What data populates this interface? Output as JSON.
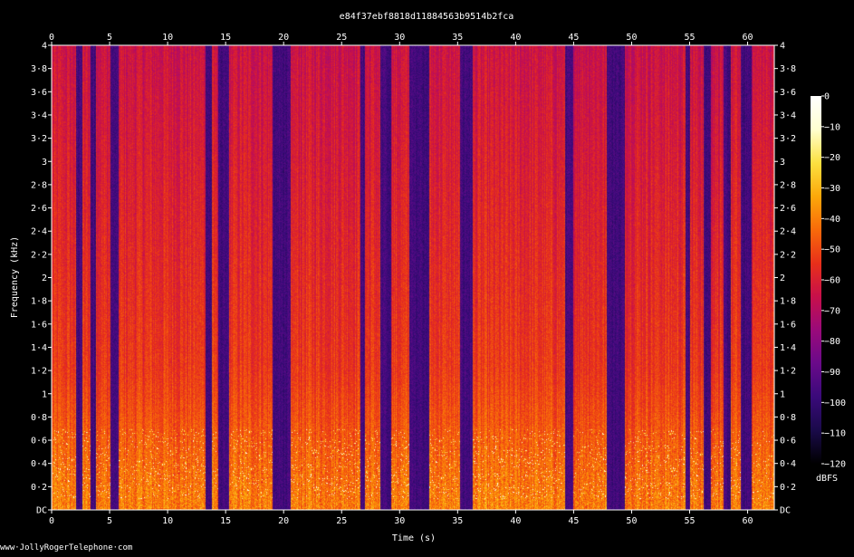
{
  "chart_data": {
    "type": "heatmap",
    "title": "e84f37ebf8818d11884563b9514b2fca",
    "xlabel": "Time (s)",
    "ylabel": "Frequency (kHz)",
    "xlim": [
      0,
      62.3
    ],
    "ylim": [
      0,
      4
    ],
    "x_ticks": [
      0,
      5,
      10,
      15,
      20,
      25,
      30,
      35,
      40,
      45,
      50,
      55,
      60
    ],
    "x_tick_labels": [
      "0",
      "5",
      "10",
      "15",
      "20",
      "25",
      "30",
      "35",
      "40",
      "45",
      "50",
      "55",
      "60"
    ],
    "y_ticks": [
      0,
      0.2,
      0.4,
      0.6,
      0.8,
      1,
      1.2,
      1.4,
      1.6,
      1.8,
      2,
      2.2,
      2.4,
      2.6,
      2.8,
      3,
      3.2,
      3.4,
      3.6,
      3.8,
      4
    ],
    "y_tick_labels": [
      "DC",
      "0·2",
      "0·4",
      "0·6",
      "0·8",
      "1",
      "1·2",
      "1·4",
      "1·6",
      "1·8",
      "2",
      "2·2",
      "2·4",
      "2·6",
      "2·8",
      "3",
      "3·2",
      "3·4",
      "3·6",
      "3·8",
      "4"
    ],
    "colorbar": {
      "label": "dBFS",
      "range": [
        -120,
        0
      ],
      "ticks": [
        0,
        -10,
        -20,
        -30,
        -40,
        -50,
        -60,
        -70,
        -80,
        -90,
        -100,
        -110,
        -120
      ],
      "tick_labels": [
        "0",
        "−10",
        "−20",
        "−30",
        "−40",
        "−50",
        "−60",
        "−70",
        "−80",
        "−90",
        "−100",
        "−110",
        "−120"
      ],
      "colormap": [
        "#000000",
        "#1a0a4a",
        "#3a0a7a",
        "#6a0a8a",
        "#9a0a7a",
        "#c8104a",
        "#e8301a",
        "#f86a0a",
        "#fca80a",
        "#fce040",
        "#ffffd0",
        "#ffffff"
      ]
    },
    "silent_intervals_s": [
      [
        2.1,
        2.6
      ],
      [
        3.3,
        3.8
      ],
      [
        5.0,
        5.7
      ],
      [
        13.2,
        13.8
      ],
      [
        14.3,
        15.3
      ],
      [
        19.0,
        20.6
      ],
      [
        26.6,
        27.0
      ],
      [
        28.3,
        29.2
      ],
      [
        30.8,
        32.5
      ],
      [
        35.2,
        36.3
      ],
      [
        44.2,
        44.9
      ],
      [
        47.8,
        49.4
      ],
      [
        54.6,
        55.0
      ],
      [
        56.2,
        56.8
      ],
      [
        57.9,
        58.5
      ],
      [
        59.4,
        60.3
      ]
    ],
    "grid": false,
    "legend": "colorbar-right"
  },
  "watermark": "www·JollyRogerTelephone·com",
  "colors": {
    "background": "#000000",
    "axis": "#ffffff"
  }
}
